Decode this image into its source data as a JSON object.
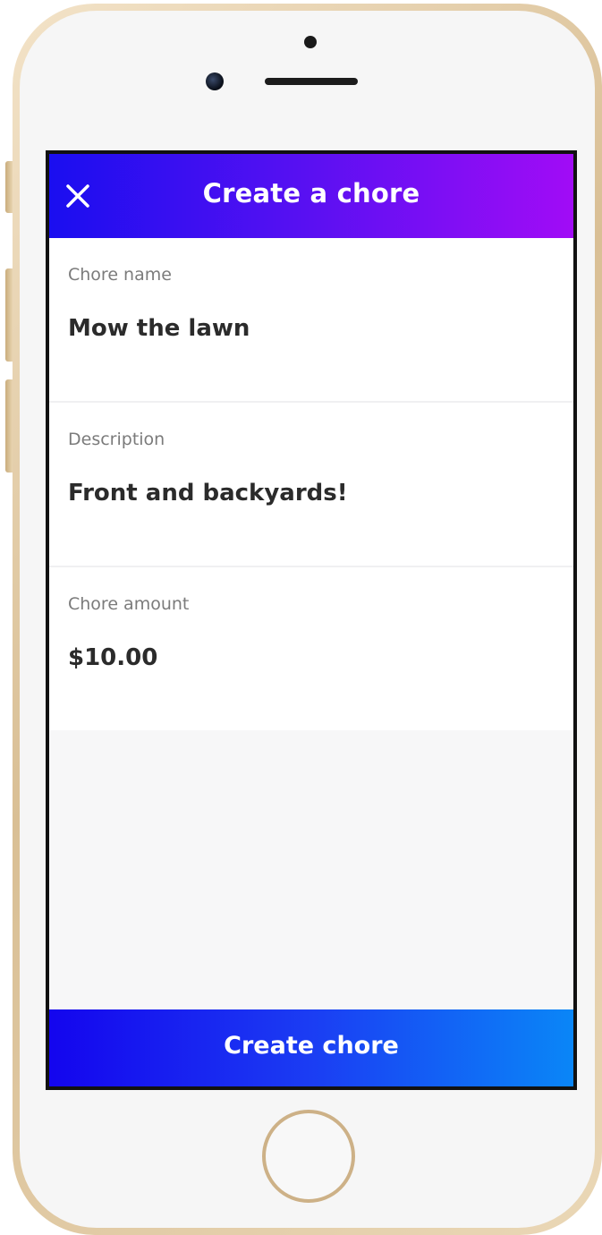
{
  "header": {
    "title": "Create a chore",
    "close_icon": "close-icon"
  },
  "form": {
    "fields": [
      {
        "label": "Chore name",
        "value": "Mow the lawn"
      },
      {
        "label": "Description",
        "value": "Front and backyards!"
      },
      {
        "label": "Chore amount",
        "value": "$10.00"
      }
    ]
  },
  "footer": {
    "button_label": "Create chore"
  },
  "colors": {
    "header_gradient_start": "#1a0ef0",
    "header_gradient_end": "#a10cf6",
    "button_gradient_start": "#1405ee",
    "button_gradient_end": "#0a86f7",
    "phone_frame": "#d9bf95"
  }
}
